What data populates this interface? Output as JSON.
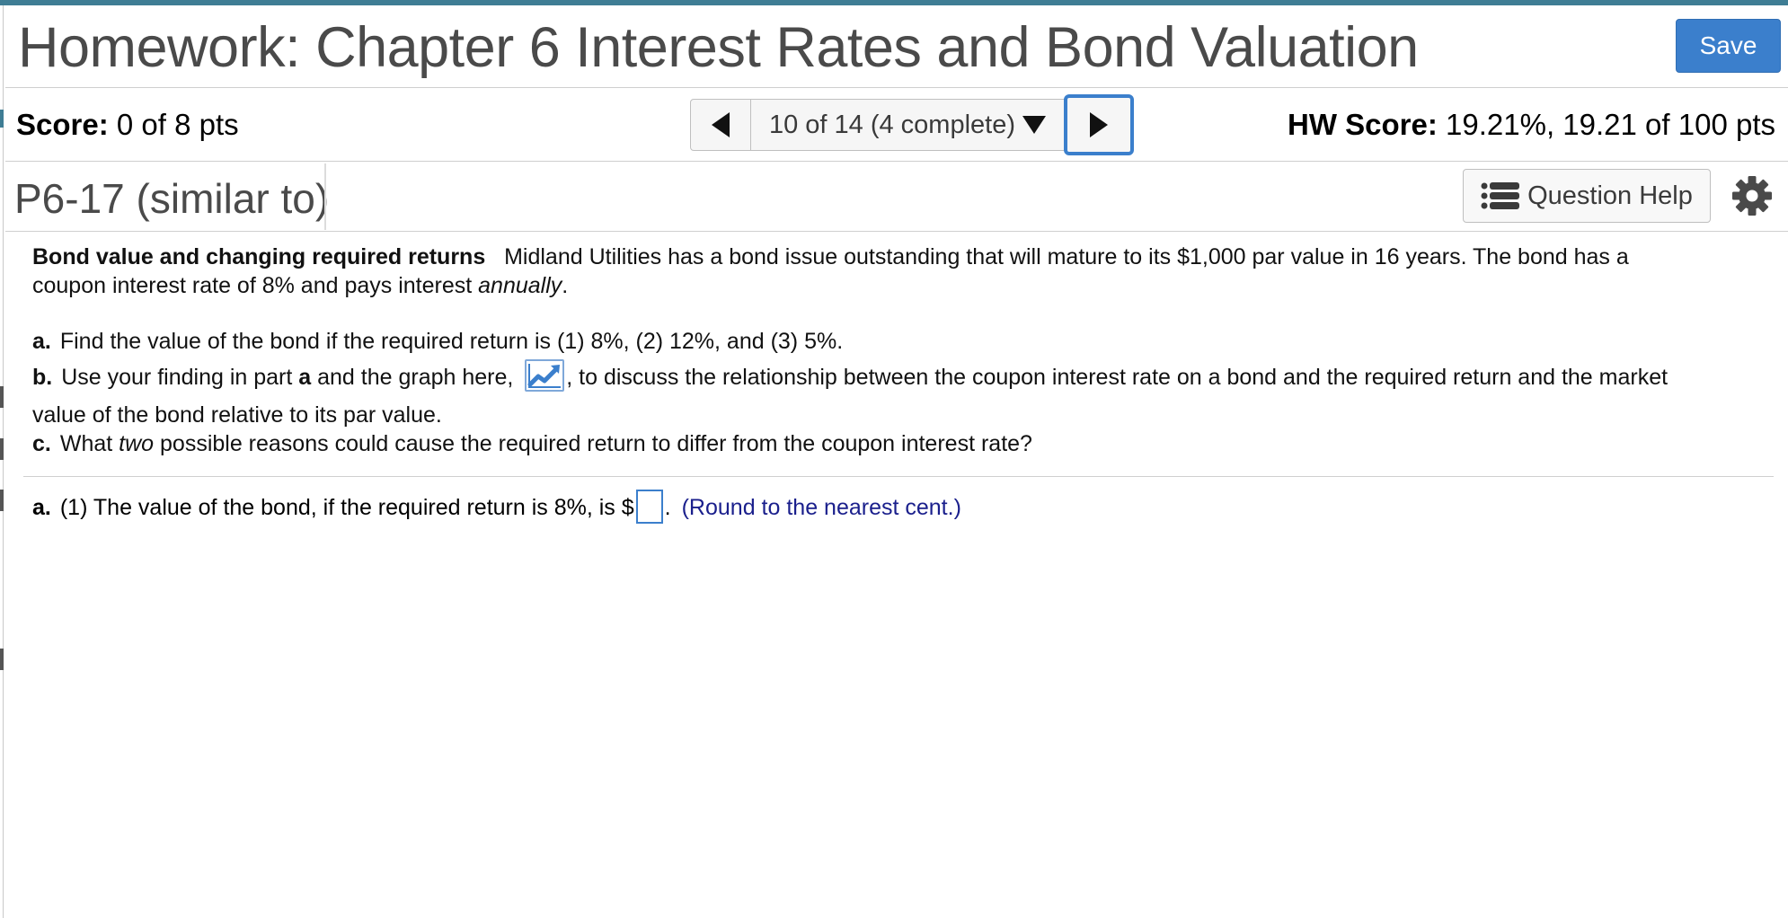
{
  "header": {
    "title": "Homework: Chapter 6 Interest Rates and Bond Valuation",
    "save_label": "Save"
  },
  "scorebar": {
    "score_label": "Score:",
    "score_value": "0 of 8 pts",
    "navigator_label": "10 of 14 (4 complete)",
    "hw_score_label": "HW Score:",
    "hw_score_value": "19.21%, 19.21 of 100 pts"
  },
  "question": {
    "id": "P6-17 (similar to)",
    "help_label": "Question Help"
  },
  "problem": {
    "title": "Bond value and changing required returns",
    "intro_1": "Midland Utilities has a bond issue outstanding that will mature to its $1,000 par value in 16 years.  The bond has a",
    "intro_2": "coupon interest rate of 8% and pays interest ",
    "intro_2_em": "annually",
    "intro_2_end": ".",
    "a_label": "a.",
    "a_text": "Find the value of the bond if the required return is (1) 8%, (2) 12%, and (3) 5%.",
    "b_label": "b.",
    "b_text_1": "Use your finding in part ",
    "b_text_bold": "a",
    "b_text_2": " and the graph here, ",
    "b_text_3": ", to discuss the relationship between the coupon interest rate on a bond and the required return and the market",
    "b_text_4": "value of the bond relative to its par value.",
    "c_label": "c.",
    "c_text_1": "What ",
    "c_text_em": "two",
    "c_text_2": " possible reasons could cause the required return to differ from the coupon interest rate?"
  },
  "answer": {
    "label": "a.",
    "text": "(1) The value of the bond, if the required return is 8%, is $",
    "after_input": ".",
    "input_value": "",
    "hint": "(Round to the nearest cent.)"
  },
  "colors": {
    "accent": "#3b7fcc",
    "top_bar": "#3f7d94",
    "hint": "#1a1f8c"
  }
}
